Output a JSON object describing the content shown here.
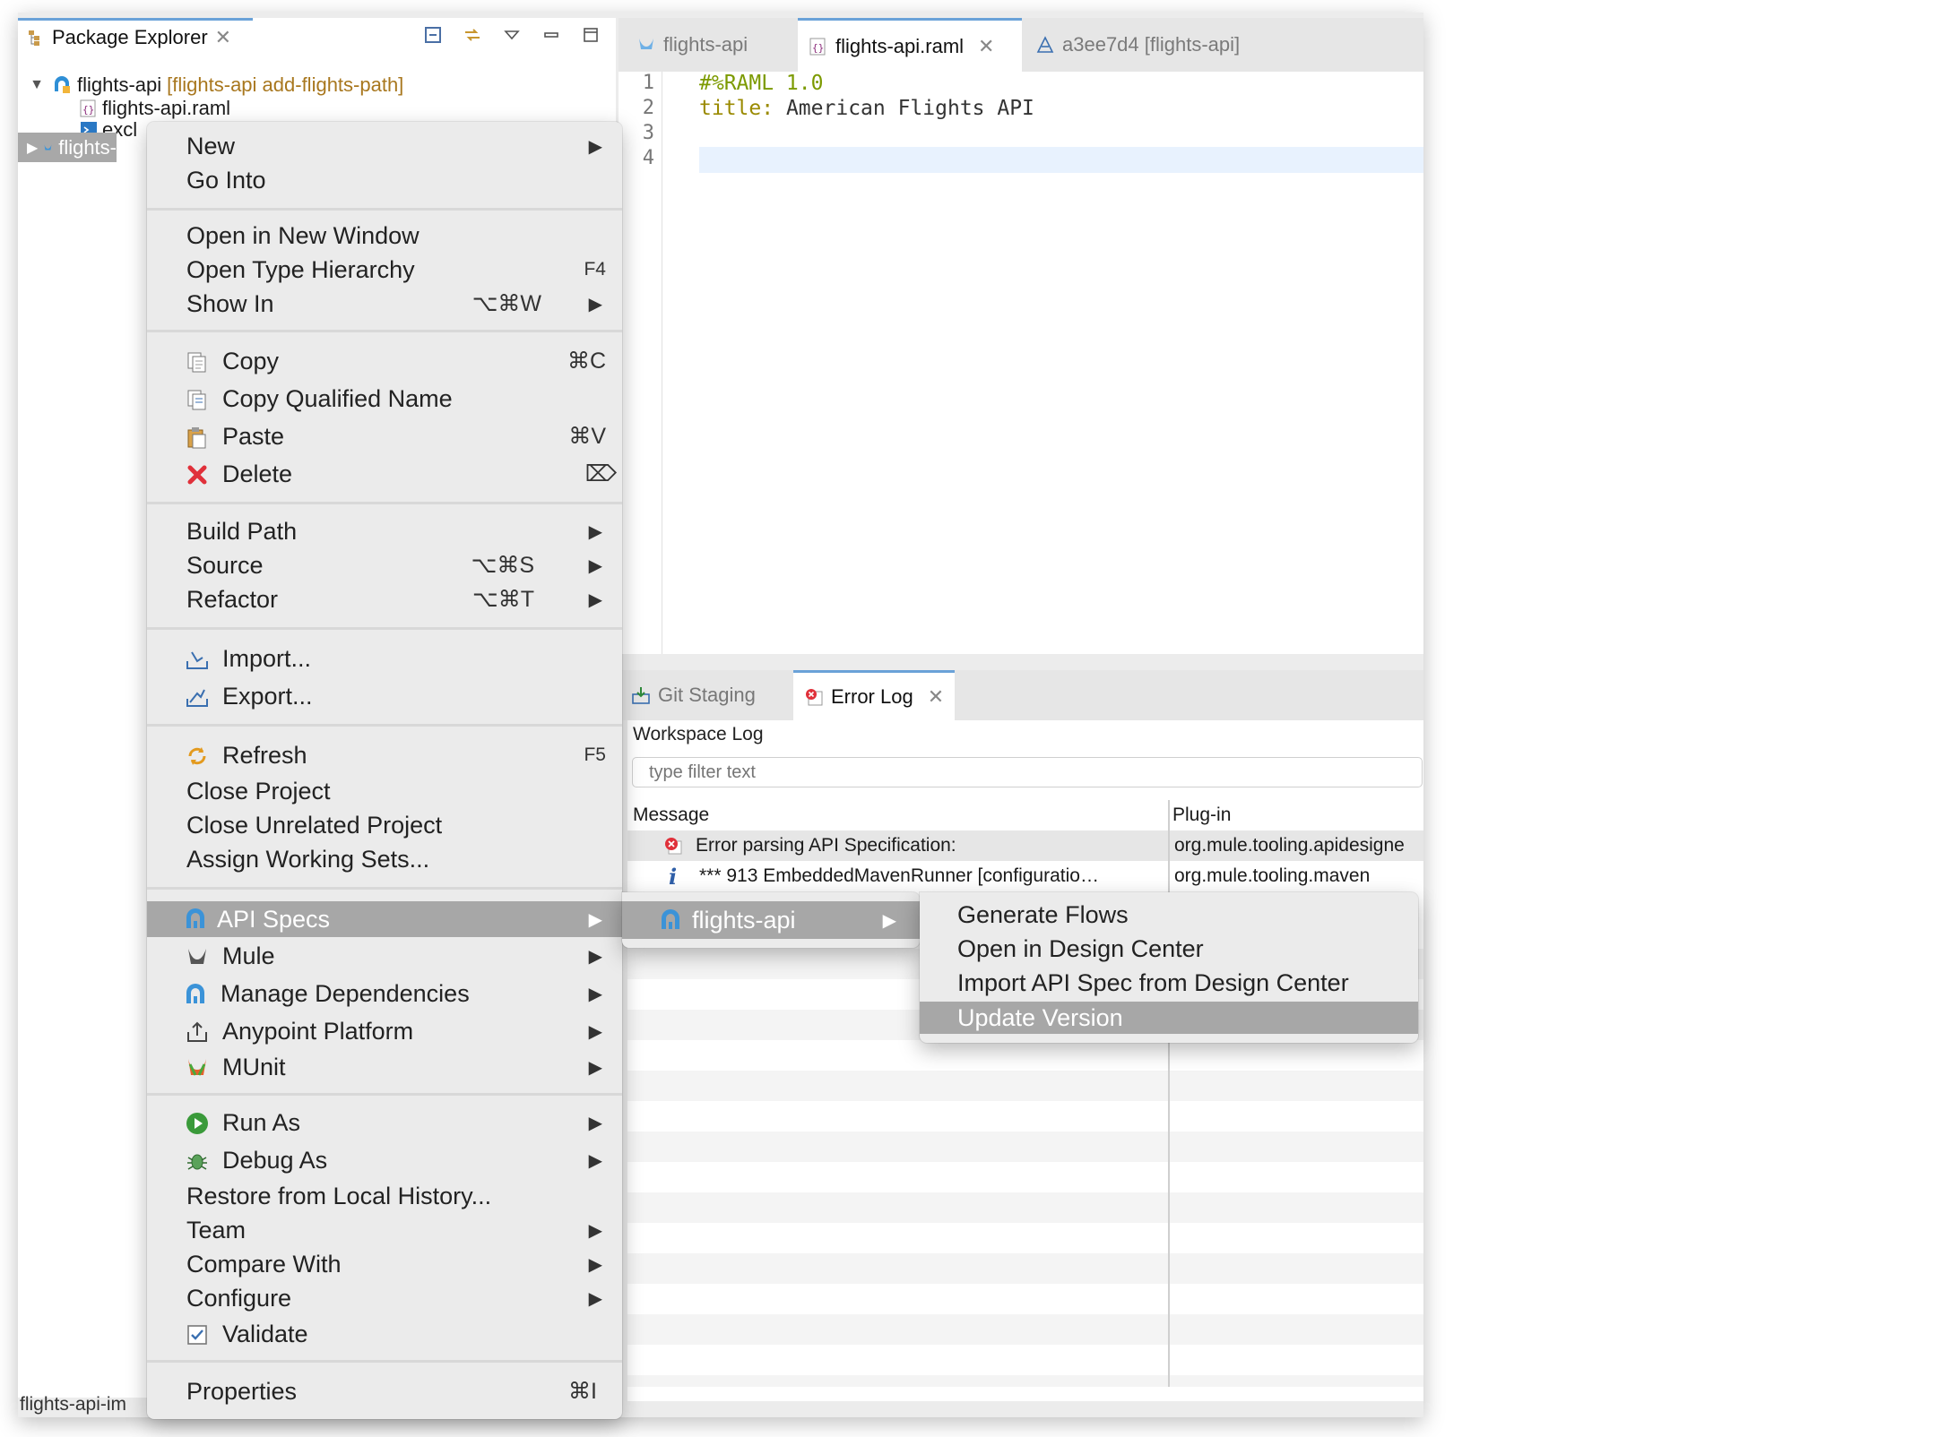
{
  "package_explorer": {
    "tab_label": "Package Explorer",
    "tree": {
      "project_name": "flights-api",
      "project_annotation": "[flights-api add-flights-path]",
      "child1": "flights-api.raml",
      "child2": "excl",
      "selected_item": "flights-"
    },
    "status_text": "flights-api-im"
  },
  "editor": {
    "tabs": [
      {
        "label": "flights-api"
      },
      {
        "label": "flights-api.raml"
      },
      {
        "label": "a3ee7d4 [flights-api]"
      }
    ],
    "line_numbers": [
      "1",
      "2",
      "3",
      "4"
    ],
    "code": {
      "line1": "#%RAML 1.0",
      "line2_key": "title:",
      "line2_val": "American Flights API"
    }
  },
  "bottom_panel": {
    "tabs": [
      {
        "label": "Git Staging"
      },
      {
        "label": "Error Log"
      }
    ],
    "workspace_label": "Workspace Log",
    "filter_placeholder": "type filter text",
    "columns": {
      "message": "Message",
      "plugin": "Plug-in"
    },
    "rows": [
      {
        "message": "Error parsing API Specification:",
        "plugin": "org.mule.tooling.apidesigne"
      },
      {
        "message": "*** 913 EmbeddedMavenRunner [configuratio…",
        "plugin": "org.mule.tooling.maven"
      }
    ]
  },
  "context_menu": {
    "new": "New",
    "go_into": "Go Into",
    "open_new_window": "Open in New Window",
    "open_type_hierarchy": "Open Type Hierarchy",
    "open_type_hierarchy_sc": "F4",
    "show_in": "Show In",
    "show_in_sc": "⌥⌘W",
    "copy": "Copy",
    "copy_sc": "⌘C",
    "copy_qualified": "Copy Qualified Name",
    "paste": "Paste",
    "paste_sc": "⌘V",
    "delete": "Delete",
    "delete_sc": "⌦",
    "build_path": "Build Path",
    "source": "Source",
    "source_sc": "⌥⌘S",
    "refactor": "Refactor",
    "refactor_sc": "⌥⌘T",
    "import": "Import...",
    "export": "Export...",
    "refresh": "Refresh",
    "refresh_sc": "F5",
    "close_project": "Close Project",
    "close_unrelated": "Close Unrelated Project",
    "assign_working_sets": "Assign Working Sets...",
    "api_specs": "API Specs",
    "mule": "Mule",
    "manage_dependencies": "Manage Dependencies",
    "anypoint_platform": "Anypoint Platform",
    "munit": "MUnit",
    "run_as": "Run As",
    "debug_as": "Debug As",
    "restore_history": "Restore from Local History...",
    "team": "Team",
    "compare_with": "Compare With",
    "configure": "Configure",
    "validate": "Validate",
    "properties": "Properties",
    "properties_sc": "⌘I"
  },
  "submenu1": {
    "item": "flights-api"
  },
  "submenu2": {
    "generate_flows": "Generate Flows",
    "open_design_center": "Open in Design Center",
    "import_api_spec": "Import API Spec from Design Center",
    "update_version": "Update Version"
  },
  "colors": {
    "accent_tab": "#6aa2d8",
    "menu_highlight": "#a7a7a7",
    "raml_comment": "#7c9a00",
    "error_red": "#e0303a",
    "info_blue": "#2f5fa8"
  }
}
